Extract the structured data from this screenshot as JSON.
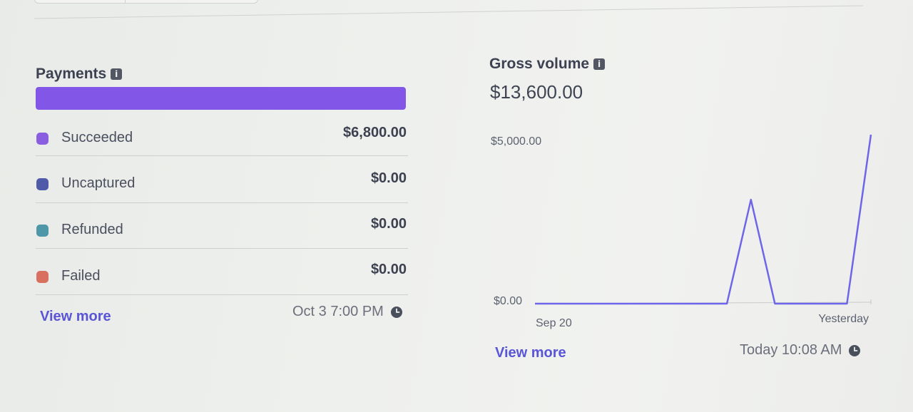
{
  "payments": {
    "title": "Payments",
    "progress_fraction": 1.0,
    "colors": {
      "bar": "#8257e8"
    },
    "rows": [
      {
        "label": "Succeeded",
        "value": "$6,800.00",
        "color": "#8a5ee0"
      },
      {
        "label": "Uncaptured",
        "value": "$0.00",
        "color": "#4f5aa8"
      },
      {
        "label": "Refunded",
        "value": "$0.00",
        "color": "#4e97a8"
      },
      {
        "label": "Failed",
        "value": "$0.00",
        "color": "#d9705f"
      }
    ],
    "view_more": "View more",
    "timestamp": "Oct 3 7:00 PM"
  },
  "gross_volume": {
    "title": "Gross volume",
    "amount": "$13,600.00",
    "view_more": "View more",
    "timestamp": "Today 10:08 AM"
  },
  "chart_data": {
    "type": "line",
    "y_ticks": [
      "$5,000.00",
      "$0.00"
    ],
    "x_ticks": [
      "Sep 20",
      "Yesterday"
    ],
    "ylim": [
      0,
      5000
    ],
    "line_color": "#6e66e8",
    "values": [
      0,
      0,
      0,
      0,
      0,
      0,
      0,
      0,
      0,
      3200,
      0,
      0,
      0,
      0,
      5200
    ]
  }
}
